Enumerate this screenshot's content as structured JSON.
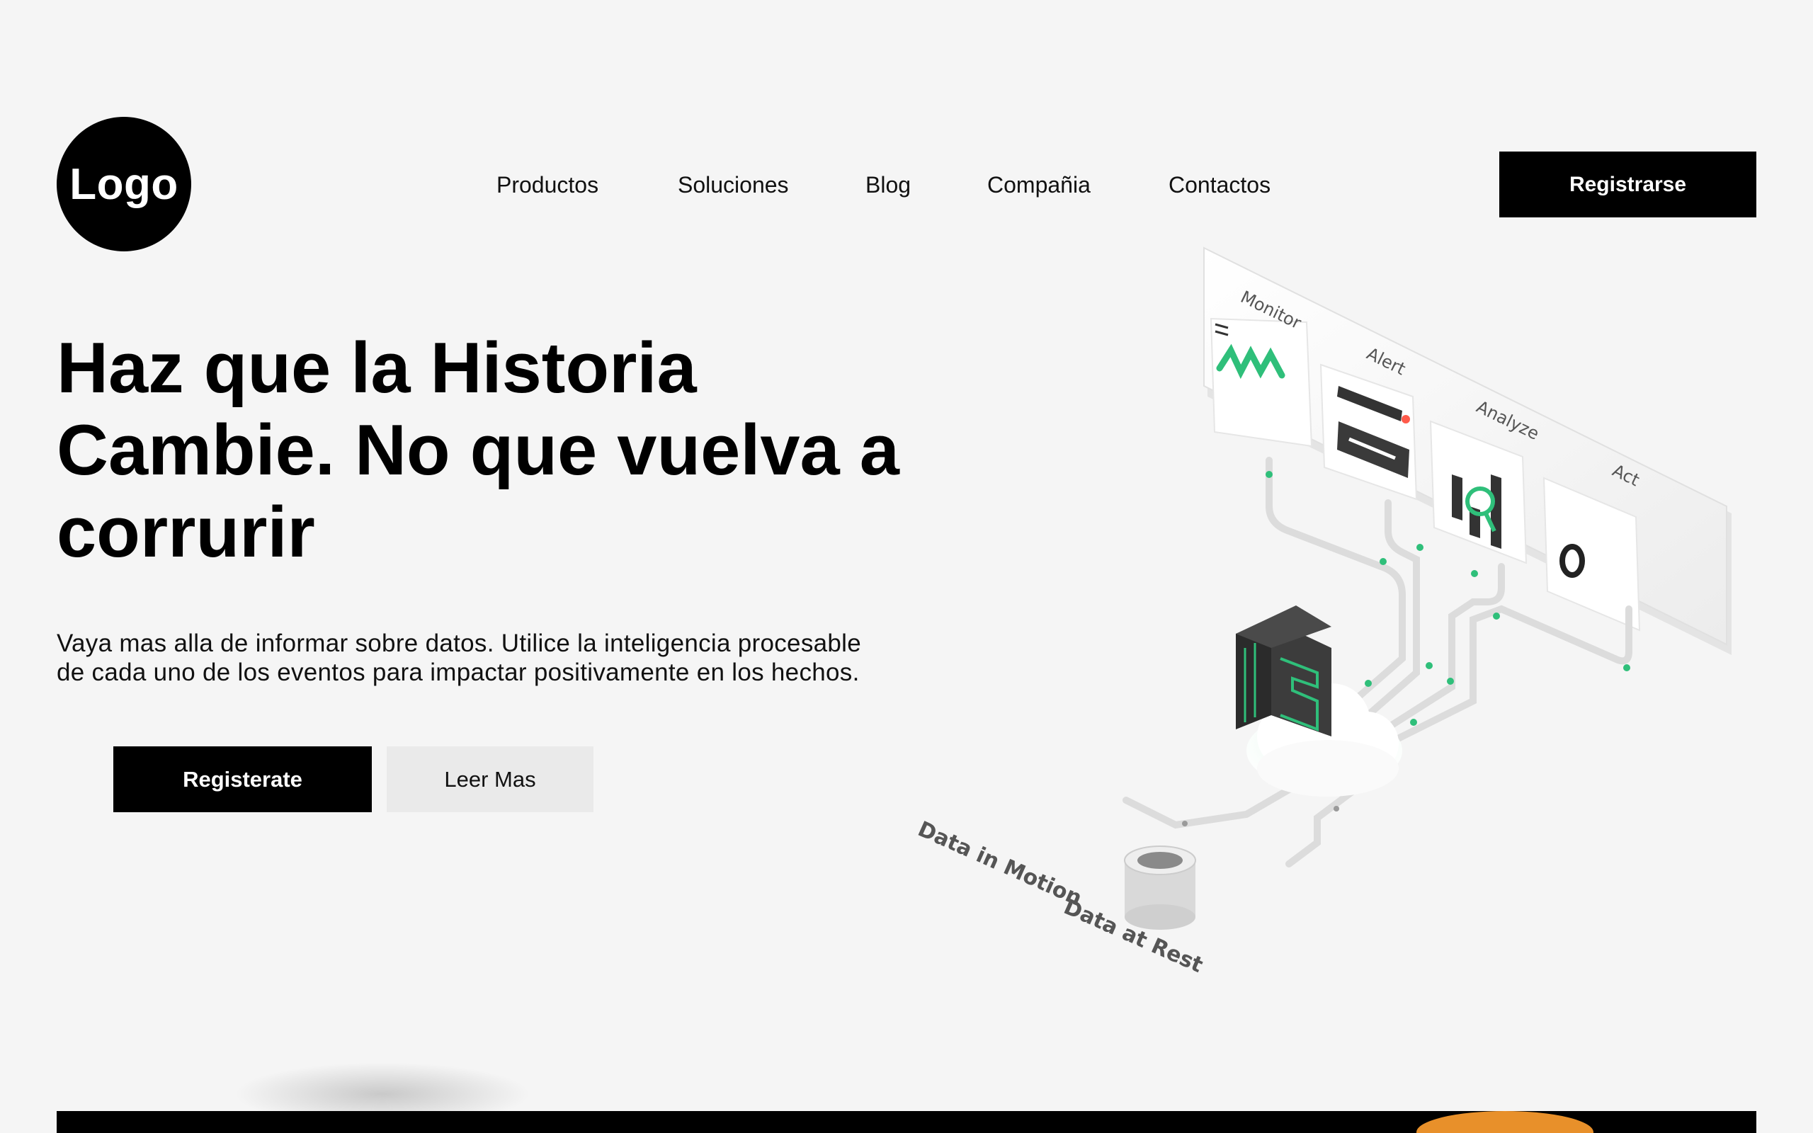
{
  "logo": {
    "text": "Logo"
  },
  "nav": {
    "items": [
      {
        "label": "Productos"
      },
      {
        "label": "Soluciones"
      },
      {
        "label": "Blog"
      },
      {
        "label": "Compañia"
      },
      {
        "label": "Contactos"
      }
    ],
    "register_label": "Registrarse"
  },
  "hero": {
    "title_lines": [
      "Haz que la Historia",
      "Cambie. No que vuelva a",
      "corrurir"
    ],
    "subtitle_lines": [
      "Vaya mas alla de informar sobre datos. Utilice la inteligencia procesable",
      "de cada uno de los eventos para impactar positivamente en los hechos."
    ],
    "primary_button": "Registerate",
    "secondary_button": "Leer Mas"
  },
  "illustration": {
    "stages": [
      "Monitor",
      "Alert",
      "Analyze",
      "Act"
    ],
    "sources": [
      "Data in Motion",
      "Data at Rest"
    ],
    "accent_color": "#2fbf7a"
  }
}
